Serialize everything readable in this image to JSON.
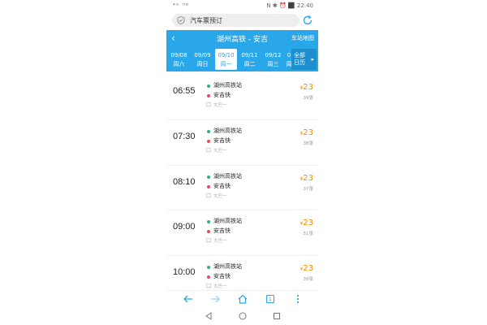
{
  "status_bar": {
    "left": "⁴ᴳ ᴴᴰ",
    "right": "N ✱ ⏰ ⬛ 22:40"
  },
  "search": {
    "text": "汽车票预订"
  },
  "header": {
    "back_label": "‹",
    "title": "湖州高铁 - 安吉",
    "map_link": "车站地图"
  },
  "dates": [
    {
      "date": "09/08",
      "weekday": "周六"
    },
    {
      "date": "09/09",
      "weekday": "周日"
    },
    {
      "date": "09/10",
      "weekday": "周一"
    },
    {
      "date": "09/11",
      "weekday": "周二"
    },
    {
      "date": "09/12",
      "weekday": "周三"
    },
    {
      "date": "0",
      "weekday": "周"
    }
  ],
  "all_dates": {
    "line1": "全部",
    "line2": "日历",
    "arrow": "▸"
  },
  "trips": [
    {
      "time": "06:55",
      "from": "湖州高铁站",
      "to": "安吉快",
      "bus_type": "大巴一",
      "currency": "¥",
      "price": "23",
      "seats": "39张"
    },
    {
      "time": "07:30",
      "from": "湖州高铁站",
      "to": "安吉快",
      "bus_type": "大巴一",
      "currency": "¥",
      "price": "23",
      "seats": "38张"
    },
    {
      "time": "08:10",
      "from": "湖州高铁站",
      "to": "安吉快",
      "bus_type": "大巴一",
      "currency": "¥",
      "price": "23",
      "seats": "37张"
    },
    {
      "time": "09:00",
      "from": "湖州高铁站",
      "to": "安吉快",
      "bus_type": "大巴一",
      "currency": "¥",
      "price": "23",
      "seats": "51张"
    },
    {
      "time": "10:00",
      "from": "湖州高铁站",
      "to": "安吉快",
      "bus_type": "大巴一",
      "currency": "¥",
      "price": "23",
      "seats": "39张"
    }
  ],
  "bottom_nav": {
    "tab_count": "1"
  },
  "colors": {
    "accent": "#2aa7e8",
    "price": "#f08a00",
    "origin_dot": "#2bb673",
    "destination_dot": "#e84a5f"
  }
}
